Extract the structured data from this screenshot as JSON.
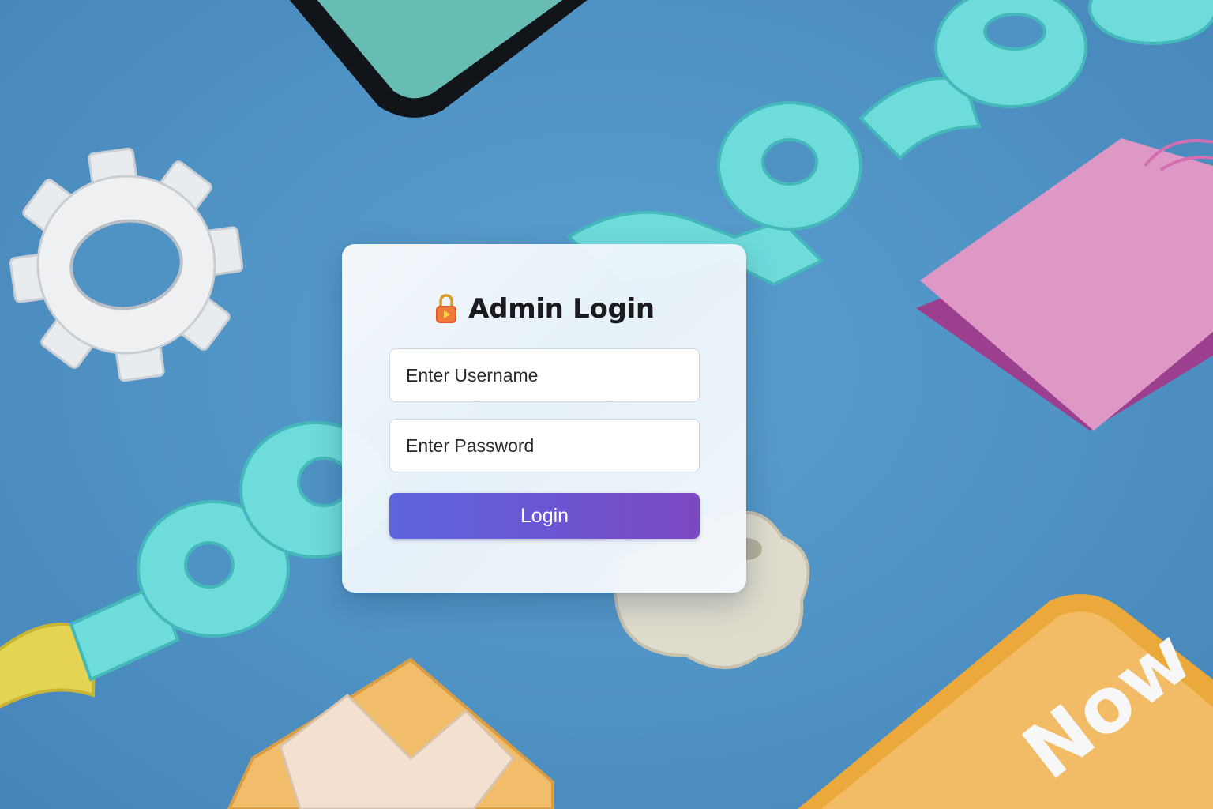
{
  "login": {
    "title": "Admin Login",
    "title_icon": "lock-icon",
    "username_placeholder": "Enter Username",
    "password_placeholder": "Enter Password",
    "button_label": "Login"
  },
  "background": {
    "sign_text": "Now",
    "colors": {
      "backdrop": "#4f92c4",
      "letters": "#6fdcdc",
      "bag": "#dd94c2",
      "sign": "#f0b84e",
      "button_start": "#5d66dc",
      "button_end": "#7b48c0"
    }
  }
}
